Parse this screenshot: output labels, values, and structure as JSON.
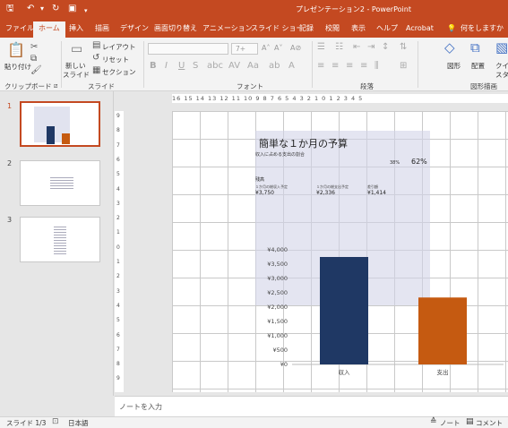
{
  "window": {
    "title": "プレゼンテーション2 - PowerPoint"
  },
  "tabs": [
    "ファイル",
    "ホーム",
    "挿入",
    "描画",
    "デザイン",
    "画面切り替え",
    "アニメーション",
    "スライド ショー",
    "記録",
    "校閲",
    "表示",
    "ヘルプ",
    "Acrobat"
  ],
  "active_tab": "ホーム",
  "tell_me": "何をしますか",
  "ribbon": {
    "paste": "貼り付け",
    "new_slide_1": "新しい",
    "new_slide_2": "スライド",
    "layout": "レイアウト",
    "reset": "リセット",
    "section": "セクション",
    "font_size": "7+",
    "shapes": "図形",
    "arrange": "配置",
    "quick_1": "クイッ",
    "quick_2": "スタイ",
    "groups": {
      "clipboard": "クリップボード",
      "slides": "スライド",
      "font": "フォント",
      "paragraph": "段落",
      "drawing": "図形描画"
    }
  },
  "thumbnails": [
    "1",
    "2",
    "3"
  ],
  "ruler_h": "16 15 14 13 12 11 10 9 8 7 6 5 4 3 2 1 0 1 2 3 4 5",
  "ruler_v": [
    "9",
    "8",
    "7",
    "6",
    "5",
    "4",
    "3",
    "2",
    "1",
    "0",
    "1",
    "2",
    "3",
    "4",
    "5",
    "6",
    "7",
    "8",
    "9"
  ],
  "slide": {
    "title": "簡単な１か月の予算",
    "subtitle": "収入に占める支出の割合",
    "pct_small": "38%",
    "pct_big": "62%",
    "balance_label": "残高",
    "columns": [
      {
        "label": "１か月の総収入予定",
        "value": "¥3,750"
      },
      {
        "label": "１か月の総支出予定",
        "value": "¥2,336"
      },
      {
        "label": "差引額",
        "value": "¥1,414"
      }
    ]
  },
  "chart_data": {
    "type": "bar",
    "categories": [
      "収入",
      "支出"
    ],
    "values": [
      3750,
      2336
    ],
    "colors": [
      "#1f3864",
      "#c55a11"
    ],
    "ylim": [
      0,
      4000
    ],
    "yticks": [
      "¥0",
      "¥500",
      "¥1,000",
      "¥1,500",
      "¥2,000",
      "¥2,500",
      "¥3,000",
      "¥3,500",
      "¥4,000"
    ]
  },
  "notes_placeholder": "ノートを入力",
  "status": {
    "slide": "スライド 1/3",
    "language": "日本語",
    "notes": "ノート",
    "comments": "コメント"
  }
}
